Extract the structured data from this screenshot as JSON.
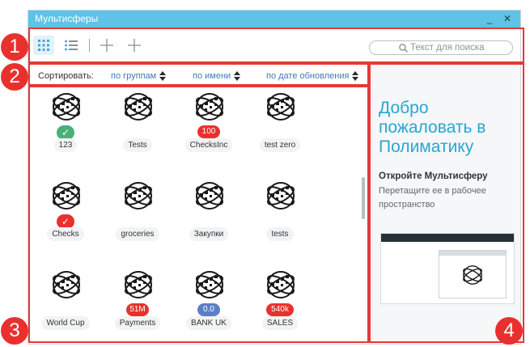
{
  "window": {
    "title": "Мультисферы",
    "minimize_glyph": "_",
    "close_glyph": "✕"
  },
  "toolbar": {
    "buttons": [
      "grid-view-icon",
      "list-view-icon",
      "add-icon",
      "add-icon"
    ],
    "search_placeholder": "Текст для поиска"
  },
  "sort": {
    "label": "Сортировать:",
    "options": [
      "по группам",
      "по имени",
      "по дате обновления"
    ]
  },
  "cubes": [
    {
      "name": "123",
      "badge": "✓",
      "badge_color": "#4caf7a"
    },
    {
      "name": "Tests",
      "badge": "",
      "badge_color": ""
    },
    {
      "name": "ChecksInc",
      "badge": "100",
      "badge_color": "#e8312f"
    },
    {
      "name": "test zero",
      "badge": "",
      "badge_color": ""
    },
    {
      "name": "Checks",
      "badge": "✓",
      "badge_color": "#e8312f"
    },
    {
      "name": "groceries",
      "badge": "",
      "badge_color": ""
    },
    {
      "name": "Закупки",
      "badge": "",
      "badge_color": ""
    },
    {
      "name": "tests",
      "badge": "",
      "badge_color": ""
    },
    {
      "name": "World Cup",
      "badge": "",
      "badge_color": ""
    },
    {
      "name": "Payments",
      "badge": "51M",
      "badge_color": "#e8312f"
    },
    {
      "name": "BANK UK",
      "badge": "0.0",
      "badge_color": "#5b7fc7"
    },
    {
      "name": "SALES",
      "badge": "540k",
      "badge_color": "#e8312f"
    }
  ],
  "welcome_panel": {
    "heading": "Добро пожаловать в Полиматику",
    "open_title": "Откройте Мультисферу",
    "open_desc": "Перетащите ее в рабочее пространство"
  },
  "annotations": [
    "1",
    "2",
    "3",
    "4"
  ],
  "colors": {
    "titlebar": "#5ec3e6",
    "accent": "#2aa6cf",
    "annotation": "#e8312f"
  }
}
